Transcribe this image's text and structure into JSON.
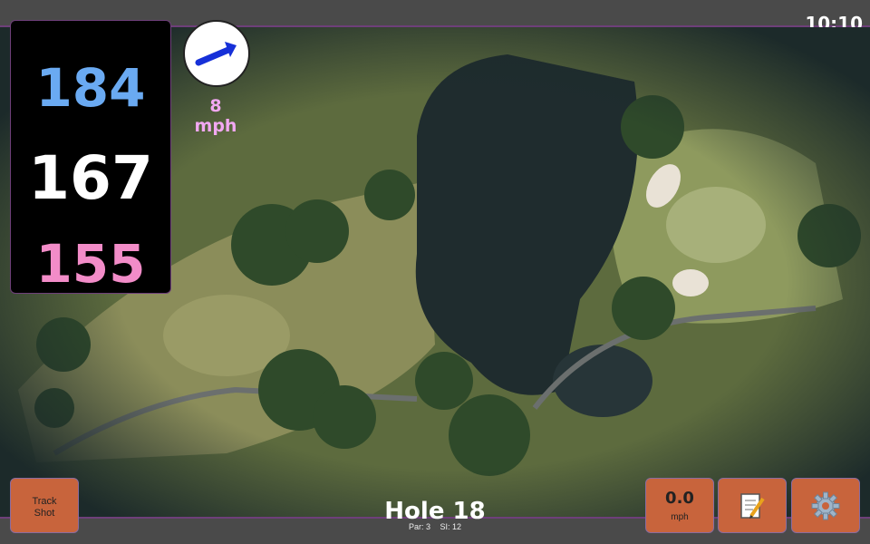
{
  "status": {
    "time": "10:10"
  },
  "distances": {
    "back": "184",
    "middle": "167",
    "front": "155",
    "colors": {
      "back": "#6aaaf2",
      "middle": "#ffffff",
      "front": "#f28cc8"
    }
  },
  "wind": {
    "speed": "8 mph",
    "direction_icon": "arrow-icon",
    "color": "#f2a8f2"
  },
  "buttons": {
    "track_shot_line1": "Track",
    "track_shot_line2": "Shot",
    "speed_value": "0.0",
    "speed_unit": "mph",
    "notes_icon": "notepad-icon",
    "settings_icon": "gear-icon"
  },
  "hole": {
    "title": "Hole 18",
    "par": "Par: 3",
    "si": "SI: 12"
  },
  "colors": {
    "accent": "#c8643c",
    "border": "#6e3f7a"
  }
}
